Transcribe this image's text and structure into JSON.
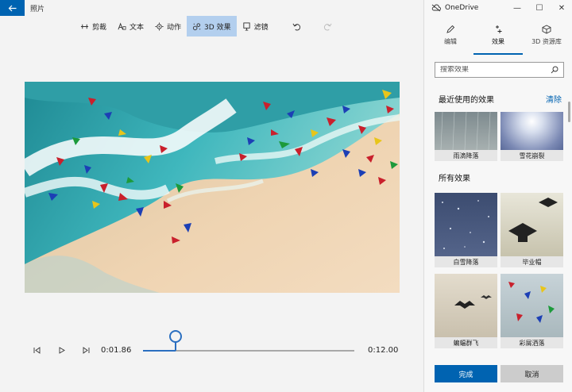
{
  "app": {
    "title": "照片",
    "toolbar": [
      {
        "id": "trim",
        "label": "剪裁",
        "icon": "trim-icon",
        "active": false
      },
      {
        "id": "text",
        "label": "文本",
        "icon": "text-icon",
        "active": false
      },
      {
        "id": "motion",
        "label": "动作",
        "icon": "motion-icon",
        "active": false
      },
      {
        "id": "effects3d",
        "label": "3D 效果",
        "icon": "effects-3d-icon",
        "active": true
      },
      {
        "id": "filters",
        "label": "滤镜",
        "icon": "filter-icon",
        "active": false
      }
    ],
    "undo_icon": "undo-icon",
    "redo_icon": "redo-icon"
  },
  "playback": {
    "current_time": "0:01.86",
    "total_time": "0:12.00",
    "progress": 0.155
  },
  "panel": {
    "window_title": "OneDrive",
    "tabs": [
      {
        "label": "编辑",
        "icon": "pencil-icon"
      },
      {
        "label": "效果",
        "icon": "sparkle-icon"
      },
      {
        "label": "3D 资源库",
        "icon": "cube-icon"
      }
    ],
    "search_placeholder": "搜索效果",
    "recent_heading": "最近使用的效果",
    "clear_label": "清除",
    "recent_effects": [
      "雨滴降落",
      "雪花崩裂"
    ],
    "all_heading": "所有效果",
    "all_effects": [
      "白雪降落",
      "毕业帽",
      "蝙蝠群飞",
      "彩屑洒落"
    ],
    "done_label": "完成",
    "cancel_label": "取消"
  },
  "colors": {
    "accent": "#0063b1",
    "toolbar_active": "#b3cfee",
    "slider": "#2b6fc0"
  }
}
